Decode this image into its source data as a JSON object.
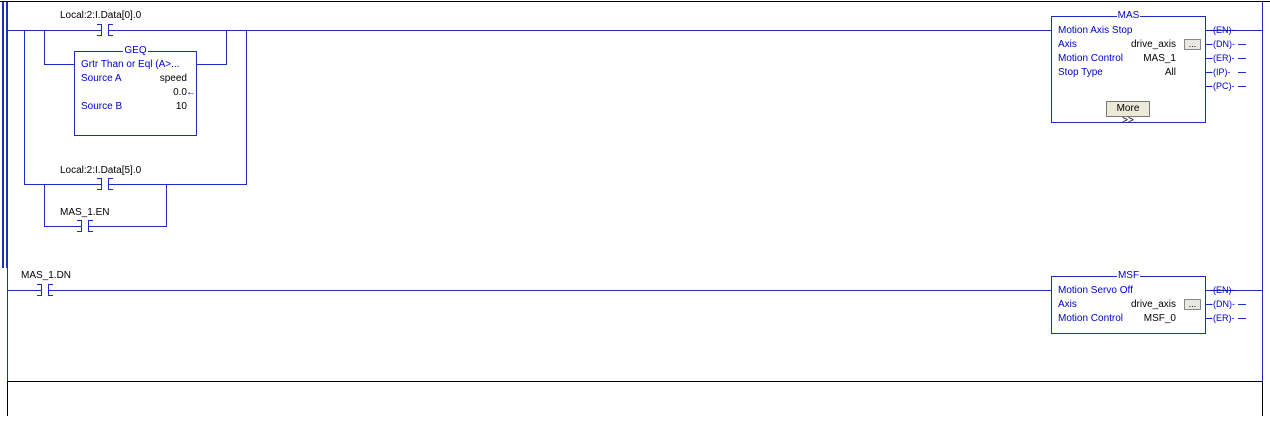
{
  "rung0": {
    "contact1_tag": "Local:2:I.Data[0].0",
    "contact2_tag": "Local:2:I.Data[5].0",
    "contact3_tag": "MAS_1.EN",
    "geq": {
      "title": "GEQ",
      "desc": "Grtr Than or Eql (A>...",
      "source_a_label": "Source A",
      "source_a_value": "speed",
      "source_a_live": "0.0",
      "source_b_label": "Source B",
      "source_b_value": "10"
    },
    "mas": {
      "title": "MAS",
      "desc": "Motion Axis Stop",
      "axis_label": "Axis",
      "axis_value": "drive_axis",
      "browse_label": "...",
      "mc_label": "Motion Control",
      "mc_value": "MAS_1",
      "stop_label": "Stop Type",
      "stop_value": "All",
      "more_label": "More >>",
      "outputs": [
        "EN",
        "DN",
        "ER",
        "IP",
        "PC"
      ]
    }
  },
  "rung1": {
    "contact_tag": "MAS_1.DN",
    "msf": {
      "title": "MSF",
      "desc": "Motion Servo Off",
      "axis_label": "Axis",
      "axis_value": "drive_axis",
      "browse_label": "...",
      "mc_label": "Motion Control",
      "mc_value": "MSF_0",
      "outputs": [
        "EN",
        "DN",
        "ER"
      ]
    }
  },
  "colors": {
    "wire": "#1a2fbf",
    "text_blue": "#0000cc",
    "separator": "#000000"
  }
}
